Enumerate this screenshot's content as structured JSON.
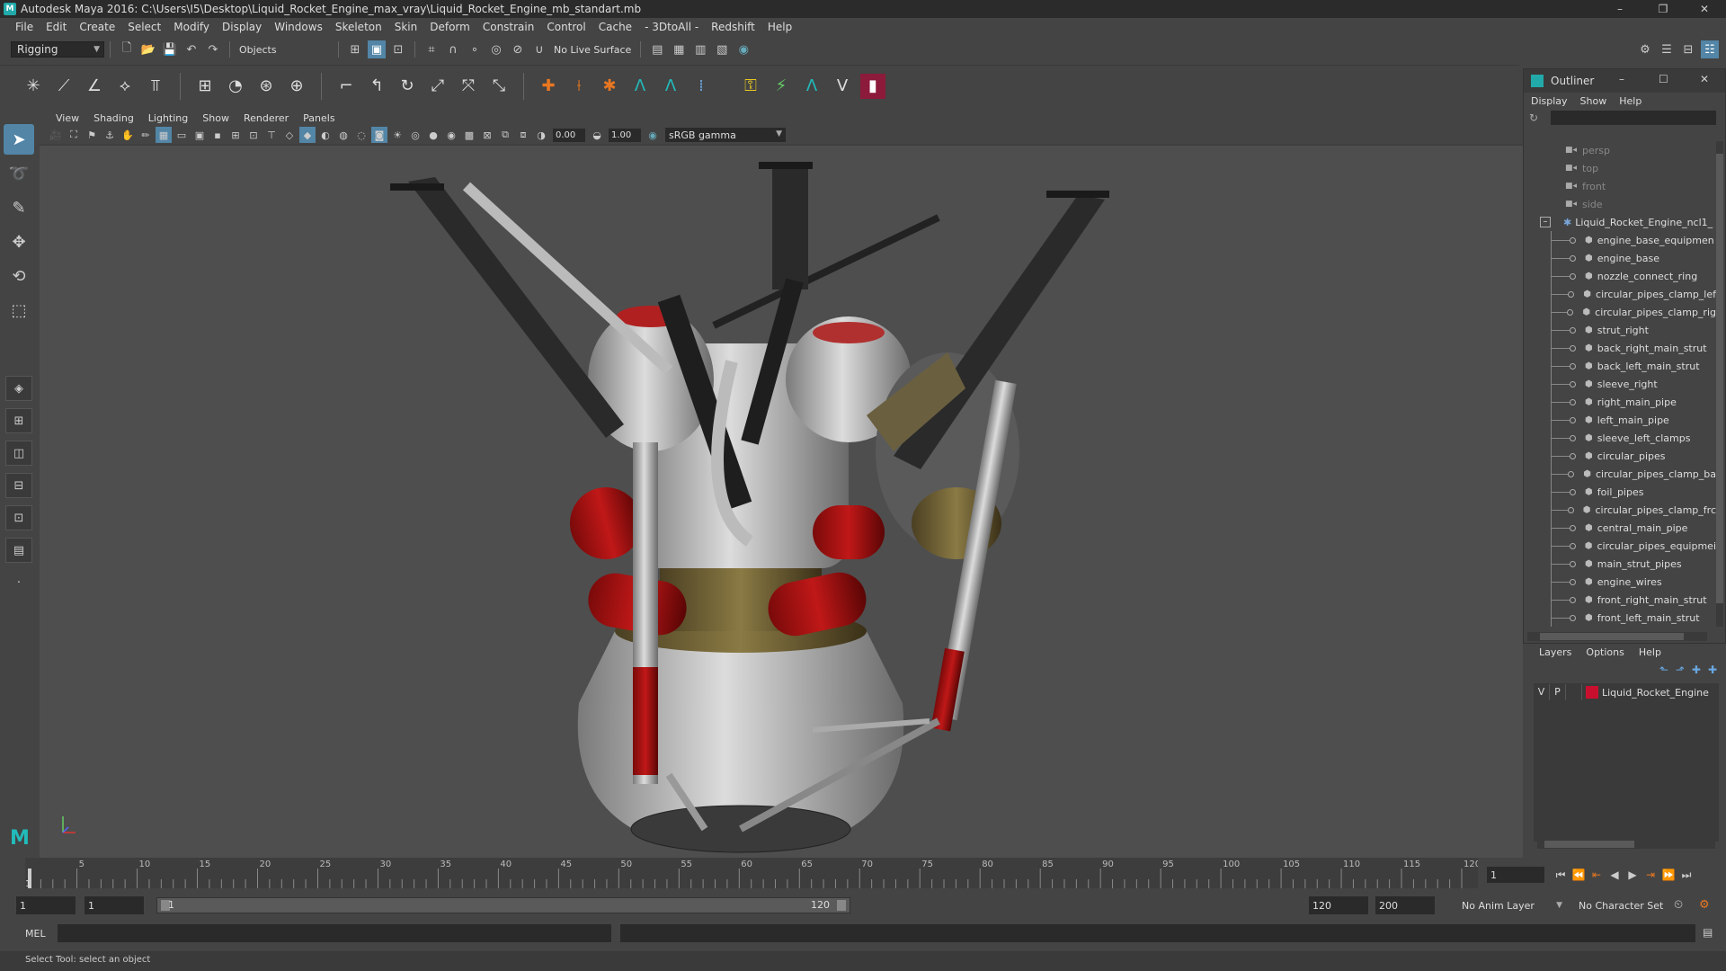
{
  "window": {
    "title": "Autodesk Maya 2016: C:\\Users\\I5\\Desktop\\Liquid_Rocket_Engine_max_vray\\Liquid_Rocket_Engine_mb_standart.mb",
    "minimize": "–",
    "restore": "❐",
    "close": "✕"
  },
  "menus": [
    "File",
    "Edit",
    "Create",
    "Select",
    "Modify",
    "Display",
    "Windows",
    "Skeleton",
    "Skin",
    "Deform",
    "Constrain",
    "Control",
    "Cache",
    "- 3DtoAll -",
    "Redshift",
    "Help"
  ],
  "statusline": {
    "mode": "Rigging",
    "select_mode": "Objects",
    "live_surface": "No Live Surface"
  },
  "panel": {
    "menus": [
      "View",
      "Shading",
      "Lighting",
      "Show",
      "Renderer",
      "Panels"
    ],
    "exposure": "0.00",
    "gamma": "1.00",
    "color_space": "sRGB gamma",
    "camera": "persp"
  },
  "outliner": {
    "title": "Outliner",
    "menus": [
      "Display",
      "Show",
      "Help"
    ],
    "cameras": [
      "persp",
      "top",
      "front",
      "side"
    ],
    "root": "Liquid_Rocket_Engine_ncl1_",
    "children": [
      "engine_base_equipmen",
      "engine_base",
      "nozzle_connect_ring",
      "circular_pipes_clamp_lef",
      "circular_pipes_clamp_rig",
      "strut_right",
      "back_right_main_strut",
      "back_left_main_strut",
      "sleeve_right",
      "right_main_pipe",
      "left_main_pipe",
      "sleeve_left_clamps",
      "circular_pipes",
      "circular_pipes_clamp_ba",
      "foil_pipes",
      "circular_pipes_clamp_frc",
      "central_main_pipe",
      "circular_pipes_equipmei",
      "main_strut_pipes",
      "engine_wires",
      "front_right_main_strut",
      "front_left_main_strut"
    ]
  },
  "layers": {
    "menus": [
      "Layers",
      "Options",
      "Help"
    ],
    "rows": [
      {
        "v": "V",
        "p": "P",
        "name": "Liquid_Rocket_Engine",
        "color": "#c8102e"
      }
    ]
  },
  "timeline": {
    "start": 1,
    "end": 120,
    "major_ticks": [
      1,
      5,
      10,
      15,
      20,
      25,
      30,
      35,
      40,
      45,
      50,
      55,
      60,
      65,
      70,
      75,
      80,
      85,
      90,
      95,
      100,
      105,
      110,
      115,
      120
    ],
    "current_frame": "1"
  },
  "range": {
    "start_field": "1",
    "playback_start": "1",
    "bar_start": "1",
    "bar_end": "120",
    "playback_end": "120",
    "end_field": "200",
    "anim_layer": "No Anim Layer",
    "character_set": "No Character Set"
  },
  "cmdline": {
    "language": "MEL"
  },
  "helpline": {
    "text": "Select Tool: select an object"
  },
  "colors": {
    "accent": "#5285a6",
    "maya_teal": "#22aaaa",
    "layer_red": "#c8102e"
  }
}
